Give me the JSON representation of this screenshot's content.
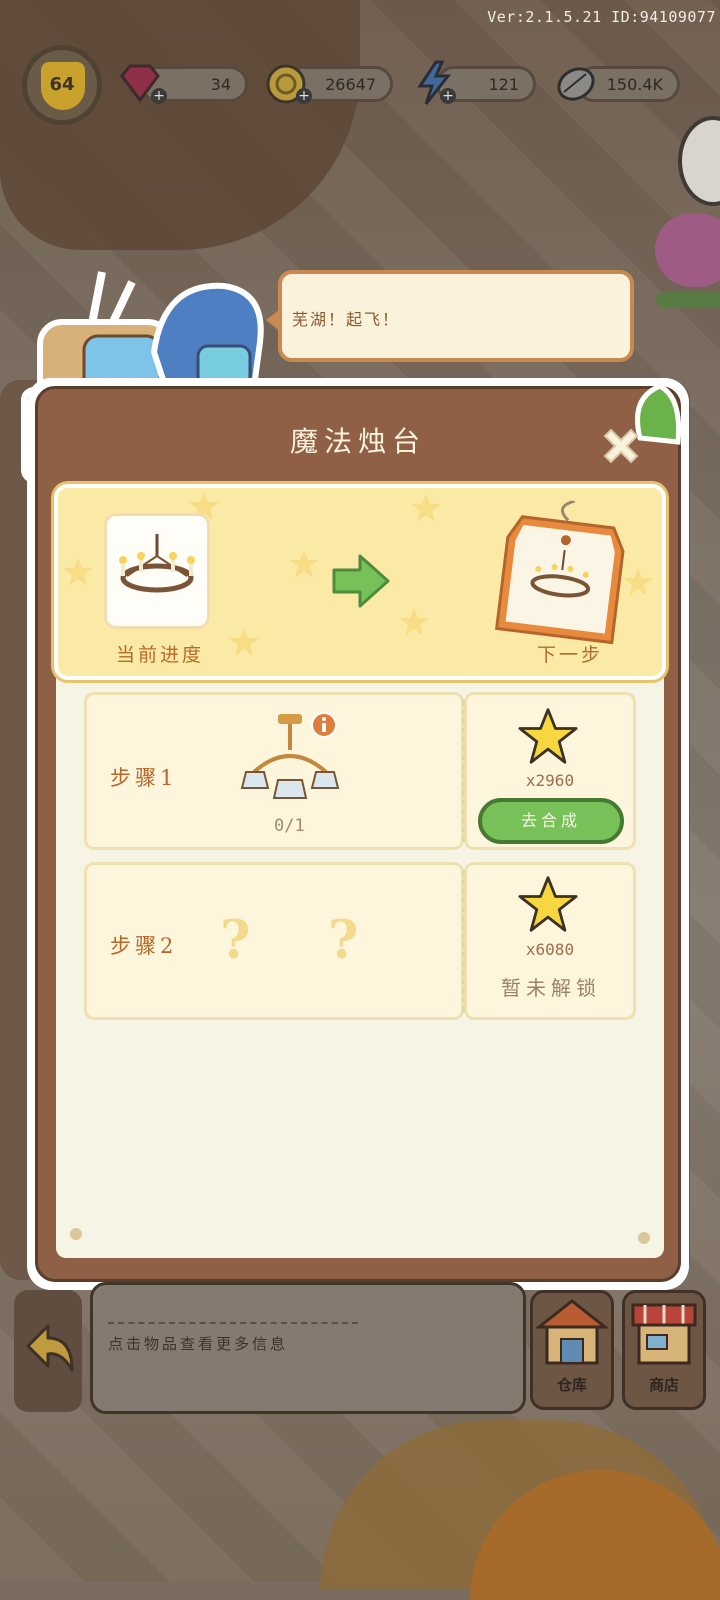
{
  "version": "Ver:2.1.5.21 ID:94109077",
  "hud": {
    "level": "64",
    "gems": "34",
    "coins": "26647",
    "energy": "121",
    "seeds": "150.4K"
  },
  "speech": "芜湖！起飞！",
  "dialog": {
    "title": "魔法烛台",
    "current_label": "当前进度",
    "next_label": "下一步",
    "steps": [
      {
        "label": "步骤1",
        "progress": "0/1",
        "reward": "x2960",
        "action": "去合成"
      },
      {
        "label": "步骤2",
        "unknown_a": "?",
        "unknown_b": "?",
        "reward": "x6080",
        "status": "暂未解锁"
      }
    ]
  },
  "bottom": {
    "hint": "点击物品查看更多信息",
    "warehouse": "仓库",
    "shop": "商店"
  },
  "colors": {
    "accent_green": "#78c058",
    "dialog_brown": "#8f6046",
    "banner_yellow": "#fbe9a6",
    "label_orange": "#b76a2d"
  }
}
